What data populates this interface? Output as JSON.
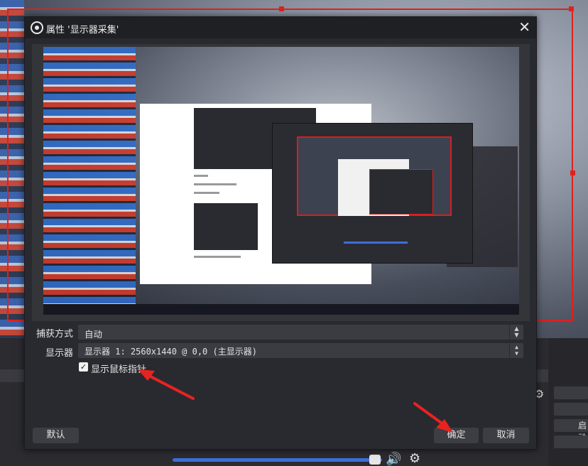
{
  "dialog": {
    "title": "属性 '显示器采集'",
    "close_icon": "close-icon"
  },
  "form": {
    "capture_method": {
      "label": "捕获方式",
      "value": "自动"
    },
    "display": {
      "label": "显示器",
      "value": "显示器 1: 2560x1440 @ 0,0 (主显示器)"
    },
    "show_cursor": {
      "label": "显示鼠标指针",
      "checked": true
    }
  },
  "buttons": {
    "default": "默认",
    "ok": "确定",
    "cancel": "取消"
  },
  "background": {
    "side_button_label": "启动",
    "icons": [
      "speaker-icon",
      "gear-icon"
    ]
  },
  "colors": {
    "selection_border": "#e02020",
    "annotation_arrow": "#e8231f",
    "dialog_bg": "#292a30"
  }
}
